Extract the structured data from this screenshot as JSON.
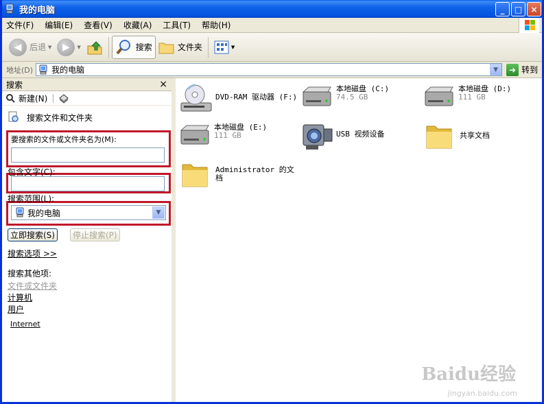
{
  "window": {
    "title": "我的电脑",
    "min": "_",
    "max": "□",
    "close": "×"
  },
  "menu": [
    "文件(F)",
    "编辑(E)",
    "查看(V)",
    "收藏(A)",
    "工具(T)",
    "帮助(H)"
  ],
  "toolbar": {
    "back": "后退",
    "search": "搜索",
    "folders": "文件夹"
  },
  "address": {
    "label": "地址(D)",
    "value": "我的电脑",
    "go": "转到"
  },
  "search_pane": {
    "title": "搜索",
    "close": "×",
    "new_label": "新建(N)",
    "heading": "搜索文件和文件夹",
    "name_label": "要搜索的文件或文件夹名为(M):",
    "name_value": "",
    "text_label": "包含文字(C):",
    "text_value": "",
    "scope_label": "搜索范围(L):",
    "scope_value": "我的电脑",
    "search_btn": "立即搜索(S)",
    "stop_btn": "停止搜索(P)",
    "options_link": "搜索选项 >>",
    "other_label": "搜索其他项:",
    "other_items": [
      "文件或文件夹",
      "计算机",
      "用户"
    ],
    "internet": "Internet"
  },
  "items": [
    {
      "name": "DVD-RAM 驱动器 (F:)",
      "sub": "",
      "icon": "dvd-drive-icon"
    },
    {
      "name": "本地磁盘 (C:)",
      "sub": "74.5 GB",
      "icon": "hard-disk-icon"
    },
    {
      "name": "本地磁盘 (D:)",
      "sub": "111 GB",
      "icon": "hard-disk-icon"
    },
    {
      "name": "本地磁盘 (E:)",
      "sub": "111 GB",
      "icon": "hard-disk-icon"
    },
    {
      "name": "USB 视频设备",
      "sub": "",
      "icon": "camera-icon"
    },
    {
      "name": "共享文档",
      "sub": "",
      "icon": "folder-icon"
    },
    {
      "name": "Administrator 的文档",
      "sub": "",
      "icon": "folder-icon"
    }
  ],
  "watermark": {
    "text": "Baidu经验",
    "url": "jingyan.baidu.com"
  },
  "colors": {
    "title_blue": "#0554e0",
    "highlight_red": "#c0172a"
  }
}
